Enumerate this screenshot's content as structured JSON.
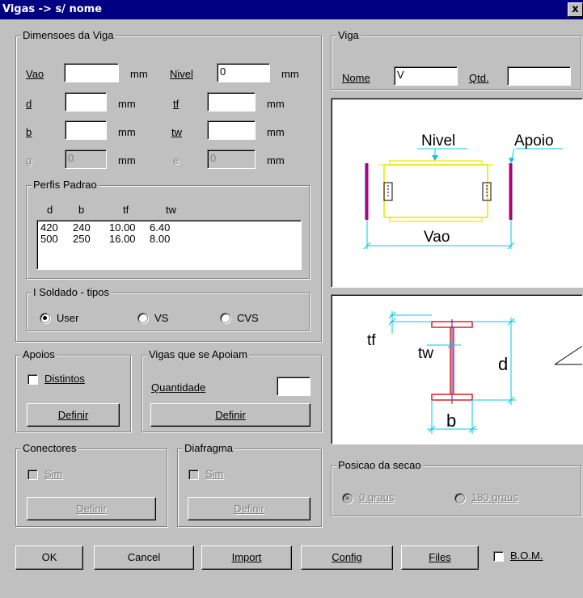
{
  "window": {
    "title": "Vigas -> s/ nome",
    "close_label": "x"
  },
  "dimensoes": {
    "legend": "Dimensoes da Viga",
    "vao": {
      "label": "Vao",
      "value": "",
      "unit": "mm"
    },
    "nivel": {
      "label": "Nivel",
      "value": "0",
      "unit": "mm"
    },
    "d": {
      "label": "d",
      "value": "",
      "unit": "mm"
    },
    "tf": {
      "label": "tf",
      "value": "",
      "unit": "mm"
    },
    "b": {
      "label": "b",
      "value": "",
      "unit": "mm"
    },
    "tw": {
      "label": "tw",
      "value": "",
      "unit": "mm"
    },
    "g": {
      "label": "g",
      "value": "0",
      "unit": "mm"
    },
    "e": {
      "label": "e",
      "value": "0",
      "unit": "mm"
    }
  },
  "perfis": {
    "legend": "Perfis Padrao",
    "columns": [
      "d",
      "b",
      "tf",
      "tw"
    ],
    "rows": [
      [
        "420",
        "240",
        "10.00",
        "6.40"
      ],
      [
        "500",
        "250",
        "16.00",
        "8.00"
      ]
    ]
  },
  "soldado": {
    "legend": "I Soldado - tipos",
    "options": [
      "User",
      "VS",
      "CVS"
    ],
    "selected": "User"
  },
  "viga": {
    "legend": "Viga",
    "nome_label": "Nome",
    "nome_value": "V",
    "qtd_label": "Qtd.",
    "qtd_value": ""
  },
  "diagram_top": {
    "nivel": "Nivel",
    "apoio": "Apoio",
    "vao": "Vao"
  },
  "diagram_section": {
    "tf": "tf",
    "tw": "tw",
    "d": "d",
    "b": "b"
  },
  "apoios": {
    "legend": "Apoios",
    "distintos_label": "Distintos",
    "distintos_checked": false,
    "definir_label": "Definir"
  },
  "vigas_apoiam": {
    "legend": "Vigas que se Apoiam",
    "quantidade_label": "Quantidade",
    "quantidade_value": "",
    "definir_label": "Definir"
  },
  "conectores": {
    "legend": "Conectores",
    "sim_label": "Sim",
    "definir_label": "Definir"
  },
  "diafragma": {
    "legend": "Diafragma",
    "sim_label": "Sim",
    "definir_label": "Definir"
  },
  "posicao": {
    "legend": "Posicao da secao",
    "options": [
      "0 graus",
      "180 graus"
    ],
    "selected": "0 graus"
  },
  "footer": {
    "ok": "OK",
    "cancel": "Cancel",
    "import": "Import",
    "config": "Config",
    "files": "Files",
    "bom_label": "B.O.M.",
    "bom_checked": false
  },
  "colors": {
    "title_bar": "#000080",
    "dialog_bg": "#c0c0c0",
    "beam_yellow": "#e8e800",
    "dimension_cyan": "#00c8e8",
    "support_magenta": "#c00070",
    "flange_red": "#e02020",
    "web_blue": "#2020c0"
  }
}
